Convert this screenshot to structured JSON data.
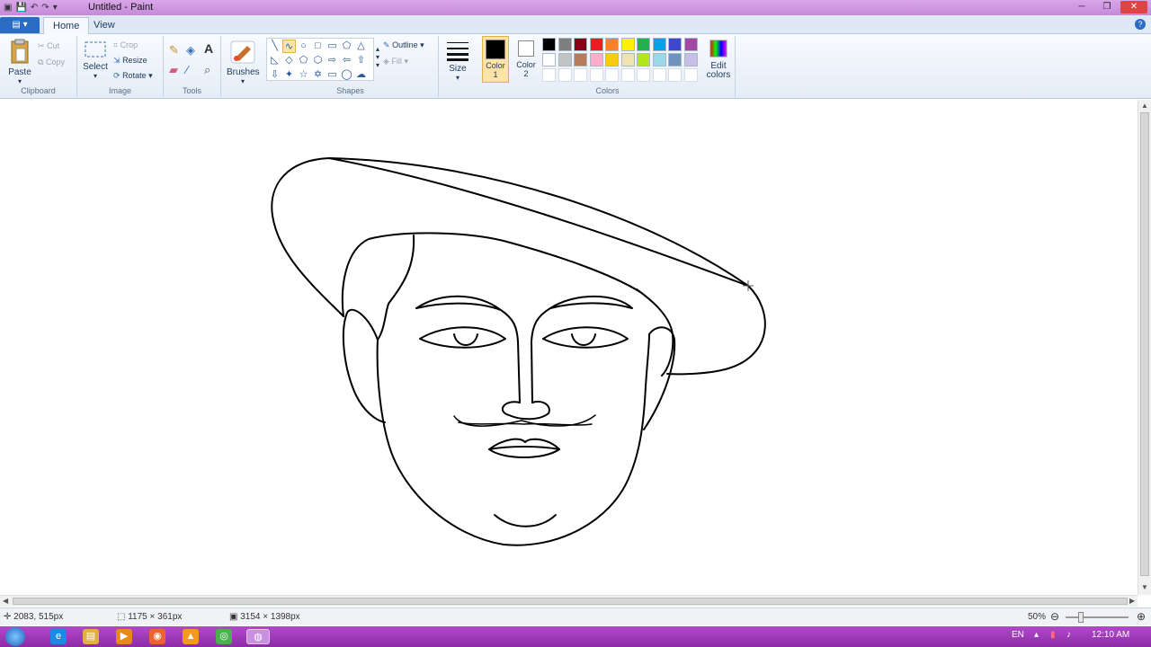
{
  "window": {
    "title": "Untitled - Paint"
  },
  "tabs": {
    "file": "",
    "home": "Home",
    "view": "View"
  },
  "clipboard": {
    "paste": "Paste",
    "cut": "Cut",
    "copy": "Copy",
    "label": "Clipboard"
  },
  "image": {
    "select": "Select",
    "crop": "Crop",
    "resize": "Resize",
    "rotate": "Rotate",
    "label": "Image"
  },
  "tools": {
    "label": "Tools"
  },
  "brushes": {
    "label": "Brushes"
  },
  "shapes": {
    "outline": "Outline",
    "fill": "Fill",
    "label": "Shapes"
  },
  "size": {
    "label": "Size"
  },
  "colors": {
    "color1_label": "Color 1",
    "color2_label": "Color 2",
    "edit_label": "Edit colors",
    "label": "Colors",
    "color1_value": "#000000",
    "color2_value": "#ffffff",
    "palette_row1": [
      "#000000",
      "#7f7f7f",
      "#880015",
      "#ed1c24",
      "#ff7f27",
      "#fff200",
      "#22b14c",
      "#00a2e8",
      "#3f48cc",
      "#a349a4"
    ],
    "palette_row2": [
      "#ffffff",
      "#c3c3c3",
      "#b97a57",
      "#ffaec9",
      "#ffc90e",
      "#efe4b0",
      "#b5e61d",
      "#99d9ea",
      "#7092be",
      "#c8bfe7"
    ]
  },
  "status": {
    "cursor_pos": "2083, 515px",
    "selection_size": "1175 × 361px",
    "image_size": "3154 × 1398px",
    "zoom": "50%"
  },
  "taskbar": {
    "lang": "EN",
    "time": "12:10 AM"
  }
}
